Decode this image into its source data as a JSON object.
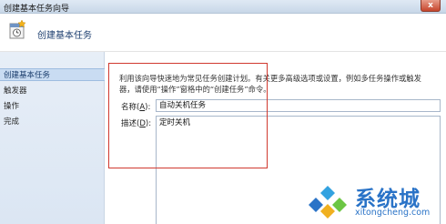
{
  "window": {
    "title": "创建基本任务向导",
    "close_glyph": "x"
  },
  "header": {
    "title": "创建基本任务",
    "icon": "task-scheduler-icon"
  },
  "sidebar": {
    "items": [
      {
        "label": "创建基本任务",
        "active": true
      },
      {
        "label": "触发器",
        "active": false
      },
      {
        "label": "操作",
        "active": false
      },
      {
        "label": "完成",
        "active": false
      }
    ]
  },
  "form": {
    "description_line1": "利用该向导快速地为常见任务创建计划。有关更多高级选项或设置，例如多任务操作或触发",
    "description_line2": "器，请使用“操作”窗格中的“创建任务”命令。",
    "name_label_prefix": "名称(",
    "name_label_key": "A",
    "name_label_suffix": "):",
    "name_value": "自动关机任务",
    "desc_label_prefix": "描述(",
    "desc_label_key": "D",
    "desc_label_suffix": "):",
    "desc_value": "定时关机"
  },
  "colors": {
    "highlight_box": "#d0392f",
    "watermark_blue": "#2a73c7"
  },
  "watermark": {
    "brand": "系统城",
    "url": "xitongcheng.com"
  }
}
